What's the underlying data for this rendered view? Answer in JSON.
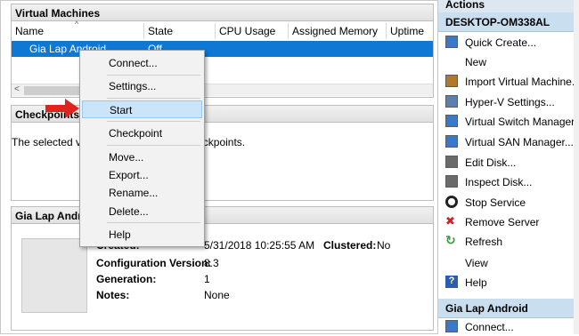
{
  "virtual_machines": {
    "title": "Virtual Machines",
    "columns": [
      "Name",
      "State",
      "CPU Usage",
      "Assigned Memory",
      "Uptime"
    ],
    "row": {
      "name": "Gia Lap Android",
      "state": "Off"
    }
  },
  "checkpoints": {
    "title": "Checkpoints",
    "empty_message": "The selected virtual machine has no checkpoints."
  },
  "details": {
    "title": "Gia Lap Android",
    "created_label": "Created:",
    "created_value": "5/31/2018 10:25:55 AM",
    "clustered_label": "Clustered:",
    "clustered_value": "No",
    "config_label": "Configuration Version:",
    "config_value": "8.3",
    "generation_label": "Generation:",
    "generation_value": "1",
    "notes_label": "Notes:",
    "notes_value": "None"
  },
  "context_menu": {
    "items": [
      "Connect...",
      "Settings...",
      "Start",
      "Checkpoint",
      "Move...",
      "Export...",
      "Rename...",
      "Delete...",
      "Help"
    ],
    "highlighted": "Start"
  },
  "actions": {
    "title": "Actions",
    "host": "DESKTOP-OM338AL",
    "host_items": [
      {
        "label": "Quick Create...",
        "icon": "quick-create-icon",
        "color": "#3a78c9"
      },
      {
        "label": "New",
        "icon": "new-icon",
        "color": "#ffffff"
      },
      {
        "label": "Import Virtual Machine...",
        "icon": "import-icon",
        "color": "#b07a2a"
      },
      {
        "label": "Hyper-V Settings...",
        "icon": "settings-icon",
        "color": "#5a7fb0"
      },
      {
        "label": "Virtual Switch Manager...",
        "icon": "switch-icon",
        "color": "#3a78c9"
      },
      {
        "label": "Virtual SAN Manager...",
        "icon": "san-icon",
        "color": "#3a78c9"
      },
      {
        "label": "Edit Disk...",
        "icon": "edit-disk-icon",
        "color": "#6a6a6a"
      },
      {
        "label": "Inspect Disk...",
        "icon": "inspect-disk-icon",
        "color": "#6a6a6a"
      },
      {
        "label": "Stop Service",
        "icon": "stop-icon",
        "color": "#222222"
      },
      {
        "label": "Remove Server",
        "icon": "remove-icon",
        "color": "#d0202a"
      },
      {
        "label": "Refresh",
        "icon": "refresh-icon",
        "color": "#2f9a3a"
      },
      {
        "label": "View",
        "icon": "view-icon",
        "color": "#ffffff"
      },
      {
        "label": "Help",
        "icon": "help-icon",
        "color": "#2a5db0"
      }
    ],
    "vm_title": "Gia Lap Android",
    "vm_items": [
      {
        "label": "Connect...",
        "icon": "connect-icon",
        "color": "#3a78c9"
      }
    ]
  },
  "colors": {
    "selection": "#0f78d4",
    "arrow": "#e0231c",
    "menu_highlight": "#cce4f7"
  }
}
